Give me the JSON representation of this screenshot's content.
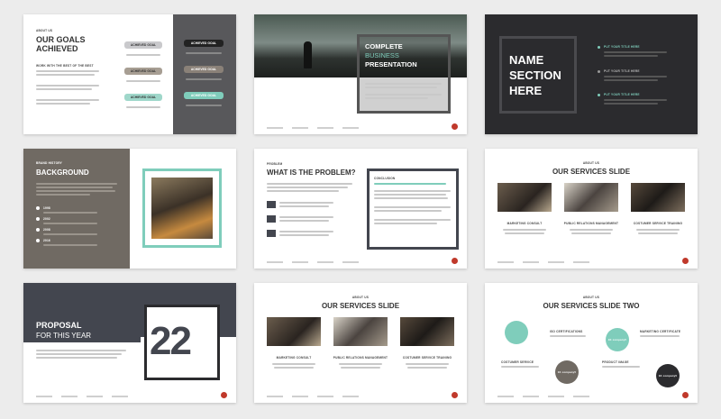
{
  "s1": {
    "tag": "ABOUT US",
    "title_line1": "OUR GOALS",
    "title_line2": "ACHIEVED",
    "subtitle": "WORK WITH THE BEST OF THE BEST",
    "goal_label": "ACHIEVED GOAL"
  },
  "s2": {
    "line1": "COMPLETE",
    "line2": "BUSINESS",
    "line3": "PRESENTATION"
  },
  "s3": {
    "line1": "NAME",
    "line2": "SECTION",
    "line3": "HERE",
    "items": [
      "PUT YOUR TITLE HERE",
      "PUT YOUR TITLE HERE",
      "PUT YOUR TITLE HERE"
    ]
  },
  "s4": {
    "tag": "BRAND HISTORY",
    "title": "BACKGROUND",
    "years": [
      "1998",
      "2002",
      "2008",
      "2016"
    ]
  },
  "s5": {
    "tag": "PROBLEM",
    "title": "WHAT IS THE PROBLEM?",
    "conclusion": "CONCLUSION"
  },
  "s6": {
    "tag": "ABOUT US",
    "title": "OUR SERVICES SLIDE",
    "services": [
      "MARKETING CONSULT",
      "PUBLIC RELATIONS MANAGEMENT",
      "COSTUMER SERVICE TRAINING"
    ]
  },
  "s7": {
    "line1": "PROPOSAL",
    "line2": "FOR THIS YEAR",
    "number": "22"
  },
  "s8": {
    "tag": "ABOUT US",
    "title": "OUR SERVICES SLIDE",
    "services": [
      "MARKETING CONSULT",
      "PUBLIC RELATIONS MANAGEMENT",
      "COSTUMER SERVICE TRAINING"
    ]
  },
  "s9": {
    "tag": "ABOUT US",
    "title": "OUR SERVICES SLIDE TWO",
    "left": [
      "ISO CERTIFICATIONS",
      "COSTUMER SERVICE"
    ],
    "right": [
      "MARKETING CERTIFICATE",
      "PRODUCT IMAGE"
    ],
    "circle": "1K company5"
  },
  "colors": {
    "teal": "#7fcdbb",
    "dark": "#2b2b2e",
    "taupe": "#706a63",
    "slate": "#43464f",
    "accent": "#c0392b"
  }
}
